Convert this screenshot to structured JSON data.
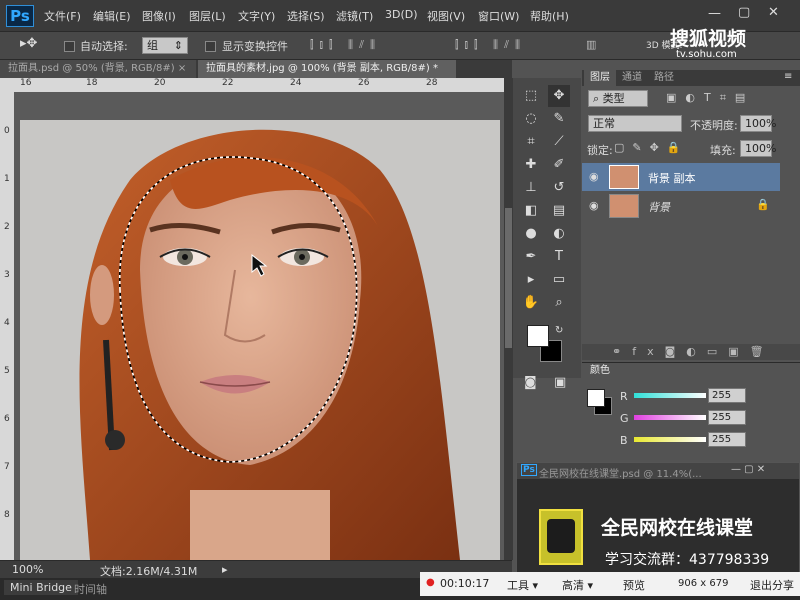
{
  "app": {
    "logo": "Ps"
  },
  "menu": [
    "文件(F)",
    "编辑(E)",
    "图像(I)",
    "图层(L)",
    "文字(Y)",
    "选择(S)",
    "滤镜(T)",
    "3D(D)",
    "视图(V)",
    "窗口(W)",
    "帮助(H)"
  ],
  "options": {
    "auto_select": "自动选择:",
    "auto_select_value": "组",
    "show_transform": "显示变换控件",
    "mode_3d": "3D 模式:"
  },
  "tabs": [
    {
      "label": "拉面具.psd @ 50% (背景, RGB/8#)",
      "close": "×"
    },
    {
      "label": "拉面具的素材.jpg @ 100% (背景 副本, RGB/8#) *",
      "close": "×"
    }
  ],
  "ruler": {
    "top": [
      "16",
      "18",
      "20",
      "22",
      "24",
      "26",
      "28"
    ],
    "left": [
      "0",
      "1",
      "2",
      "3",
      "4",
      "5",
      "6",
      "7",
      "8"
    ]
  },
  "status": {
    "zoom": "100%",
    "doc": "文档:2.16M/4.31M"
  },
  "bottom": {
    "mini_bridge": "Mini Bridge",
    "timeline": "时间轴"
  },
  "layers_panel": {
    "tabs": [
      "图层",
      "通道",
      "路径"
    ],
    "filter": "类型",
    "blend": "正常",
    "opacity_label": "不透明度:",
    "opacity": "100%",
    "lock_label": "锁定:",
    "fill_label": "填充:",
    "fill": "100%",
    "layers": [
      {
        "name": "背景 副本",
        "selected": true
      },
      {
        "name": "背景",
        "selected": false
      }
    ]
  },
  "color_panel": {
    "tab": "颜色",
    "channels": [
      {
        "label": "R",
        "value": "255",
        "color": "#30e0d8"
      },
      {
        "label": "G",
        "value": "255",
        "color": "#e040e0"
      },
      {
        "label": "B",
        "value": "255",
        "color": "#e8e830"
      }
    ]
  },
  "mini_window": {
    "title": "全民网校在线课堂.psd @ 11.4%(...",
    "brand": "全民网校在线课堂",
    "qq": "学习交流群：437798339"
  },
  "watermark": {
    "name": "搜狐视频",
    "url": "tv.sohu.com"
  },
  "player": {
    "time": "00:10:17",
    "tools": "工具",
    "quality": "高清",
    "preview": "预览",
    "resolution": "906 x 679",
    "exit": "退出分享"
  }
}
